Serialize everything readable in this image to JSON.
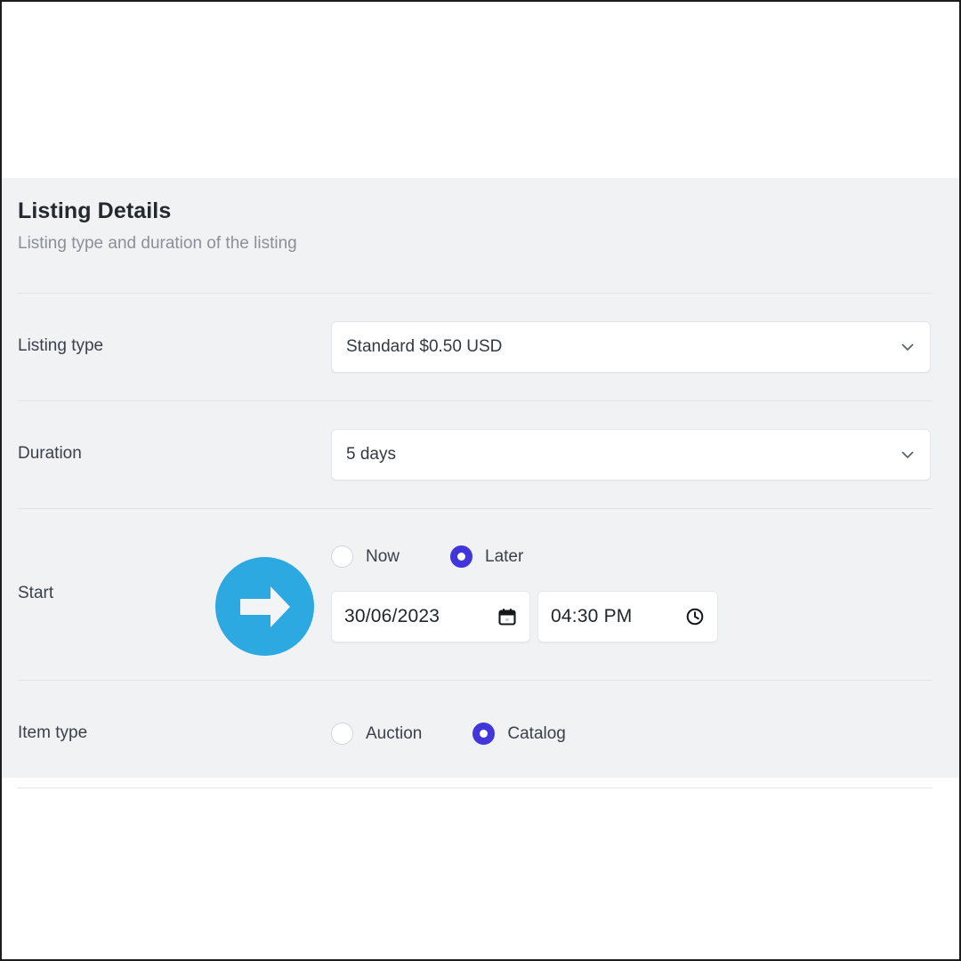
{
  "panel": {
    "title": "Listing Details",
    "subtitle": "Listing type and duration of the listing"
  },
  "fields": {
    "listing_type": {
      "label": "Listing type",
      "value": "Standard $0.50 USD",
      "caret_icon": "chevron-down-icon"
    },
    "duration": {
      "label": "Duration",
      "value": "5 days",
      "caret_icon": "chevron-down-icon"
    },
    "start": {
      "label": "Start",
      "options": [
        {
          "label": "Now",
          "selected": false
        },
        {
          "label": "Later",
          "selected": true
        }
      ],
      "date": {
        "value": "30/06/2023",
        "icon": "calendar-icon"
      },
      "time": {
        "value": "04:30 PM",
        "icon": "clock-icon"
      }
    },
    "item_type": {
      "label": "Item type",
      "options": [
        {
          "label": "Auction",
          "selected": false
        },
        {
          "label": "Catalog",
          "selected": true
        }
      ]
    }
  },
  "annotation": {
    "icon": "arrow-right-icon"
  },
  "colors": {
    "panel_background": "#f1f2f4",
    "radio_selected": "#4036db",
    "annotation_circle": "#2ba9e0",
    "title_text": "#24292f",
    "subtitle_text": "#8a8f98"
  }
}
